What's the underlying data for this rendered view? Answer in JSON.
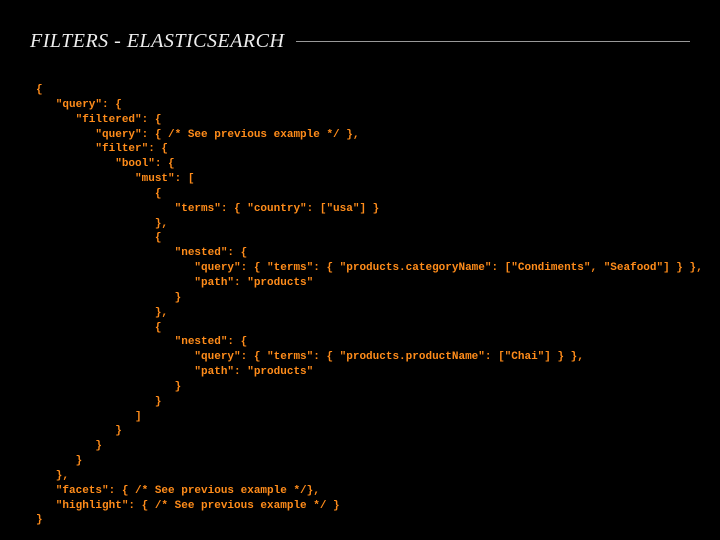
{
  "title": "FILTERS - ELASTICSEARCH",
  "code": "{\n   \"query\": {\n      \"filtered\": {\n         \"query\": { /* See previous example */ },\n         \"filter\": {\n            \"bool\": {\n               \"must\": [\n                  {\n                     \"terms\": { \"country\": [\"usa\"] }\n                  },\n                  {\n                     \"nested\": {\n                        \"query\": { \"terms\": { \"products.categoryName\": [\"Condiments\", \"Seafood\"] } },\n                        \"path\": \"products\"\n                     }\n                  },\n                  {\n                     \"nested\": {\n                        \"query\": { \"terms\": { \"products.productName\": [\"Chai\"] } },\n                        \"path\": \"products\"\n                     }\n                  }\n               ]\n            }\n         }\n      }\n   },\n   \"facets\": { /* See previous example */},\n   \"highlight\": { /* See previous example */ }\n}"
}
